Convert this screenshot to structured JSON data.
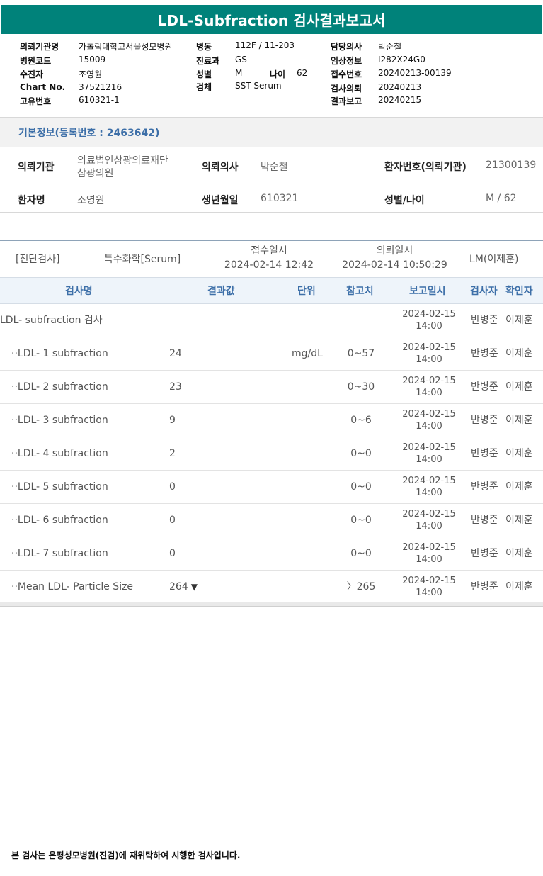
{
  "report": {
    "title": "LDL-Subfraction 검사결과보고서"
  },
  "info": {
    "left": [
      {
        "label": "의뢰기관명",
        "value": "가톨릭대학교서울성모병원"
      },
      {
        "label": "병원코드",
        "value": "15009"
      },
      {
        "label": "수진자",
        "value": "조영원"
      },
      {
        "label": "Chart No.",
        "value": "37521216"
      },
      {
        "label": "고유번호",
        "value": "610321-1"
      }
    ],
    "middle": [
      {
        "label": "병동",
        "value": "112F / 11-203"
      },
      {
        "label": "진료과",
        "value": "GS"
      },
      {
        "label": "성별",
        "value": "M"
      },
      {
        "label": "검체",
        "value": "SST Serum"
      }
    ],
    "age": {
      "label": "나이",
      "value": "62"
    },
    "right": [
      {
        "label": "담당의사",
        "value": "박순철"
      },
      {
        "label": "임상정보",
        "value": "I282X24G0"
      },
      {
        "label": "접수번호",
        "value": "20240213-00139"
      },
      {
        "label": "검사의뢰",
        "value": "20240213"
      },
      {
        "label": "결과보고",
        "value": "20240215"
      }
    ]
  },
  "basic": {
    "title": "기본정보(등록번호 : 2463642)",
    "institution_label": "의뢰기관",
    "institution_line1": "의료법인삼광의료재단",
    "institution_line2": "삼광의원",
    "doctor_label": "의뢰의사",
    "doctor_value": "박순철",
    "patient_no_label": "환자번호(의뢰기관)",
    "patient_no_value": "21300139",
    "name_label": "환자명",
    "name_value": "조영원",
    "birth_label": "생년월일",
    "birth_value": "610321",
    "sex_age_label": "성별/나이",
    "sex_age_value": "M / 62"
  },
  "test_header": {
    "category": "[진단검사]",
    "type": "특수화학[Serum]",
    "received_label": "접수일시",
    "received_value": "2024-02-14 12:42",
    "requested_label": "의뢰일시",
    "requested_value": "2024-02-14 10:50:29",
    "lab": "LM(이제훈)"
  },
  "columns": {
    "name": "검사명",
    "result": "결과값",
    "unit": "단위",
    "ref": "참고치",
    "report_date": "보고일시",
    "tester": "검사자",
    "confirmer": "확인자"
  },
  "rows": [
    {
      "name": "LDL- subfraction 검사",
      "result": "",
      "unit": "",
      "ref": "",
      "date": "2024-02-15",
      "time": "14:00",
      "tester": "반병준",
      "confirmer": "이제훈"
    },
    {
      "name": "··LDL- 1 subfraction",
      "result": "24",
      "unit": "mg/dL",
      "ref": "0~57",
      "date": "2024-02-15",
      "time": "14:00",
      "tester": "반병준",
      "confirmer": "이제훈"
    },
    {
      "name": "··LDL- 2 subfraction",
      "result": "23",
      "unit": "",
      "ref": "0~30",
      "date": "2024-02-15",
      "time": "14:00",
      "tester": "반병준",
      "confirmer": "이제훈"
    },
    {
      "name": "··LDL- 3 subfraction",
      "result": "9",
      "unit": "",
      "ref": "0~6",
      "date": "2024-02-15",
      "time": "14:00",
      "tester": "반병준",
      "confirmer": "이제훈"
    },
    {
      "name": "··LDL- 4 subfraction",
      "result": "2",
      "unit": "",
      "ref": "0~0",
      "date": "2024-02-15",
      "time": "14:00",
      "tester": "반병준",
      "confirmer": "이제훈"
    },
    {
      "name": "··LDL- 5 subfraction",
      "result": "0",
      "unit": "",
      "ref": "0~0",
      "date": "2024-02-15",
      "time": "14:00",
      "tester": "반병준",
      "confirmer": "이제훈"
    },
    {
      "name": "··LDL- 6 subfraction",
      "result": "0",
      "unit": "",
      "ref": "0~0",
      "date": "2024-02-15",
      "time": "14:00",
      "tester": "반병준",
      "confirmer": "이제훈"
    },
    {
      "name": "··LDL- 7 subfraction",
      "result": "0",
      "unit": "",
      "ref": "0~0",
      "date": "2024-02-15",
      "time": "14:00",
      "tester": "반병준",
      "confirmer": "이제훈"
    },
    {
      "name": "··Mean LDL- Particle Size",
      "result": "264",
      "flag": "▼",
      "unit": "",
      "ref": "〉265",
      "date": "2024-02-15",
      "time": "14:00",
      "tester": "반병준",
      "confirmer": "이제훈"
    }
  ],
  "footer": {
    "note": "본 검사는 은평성모병원(진검)에 재위탁하여 시행한 검사입니다."
  }
}
